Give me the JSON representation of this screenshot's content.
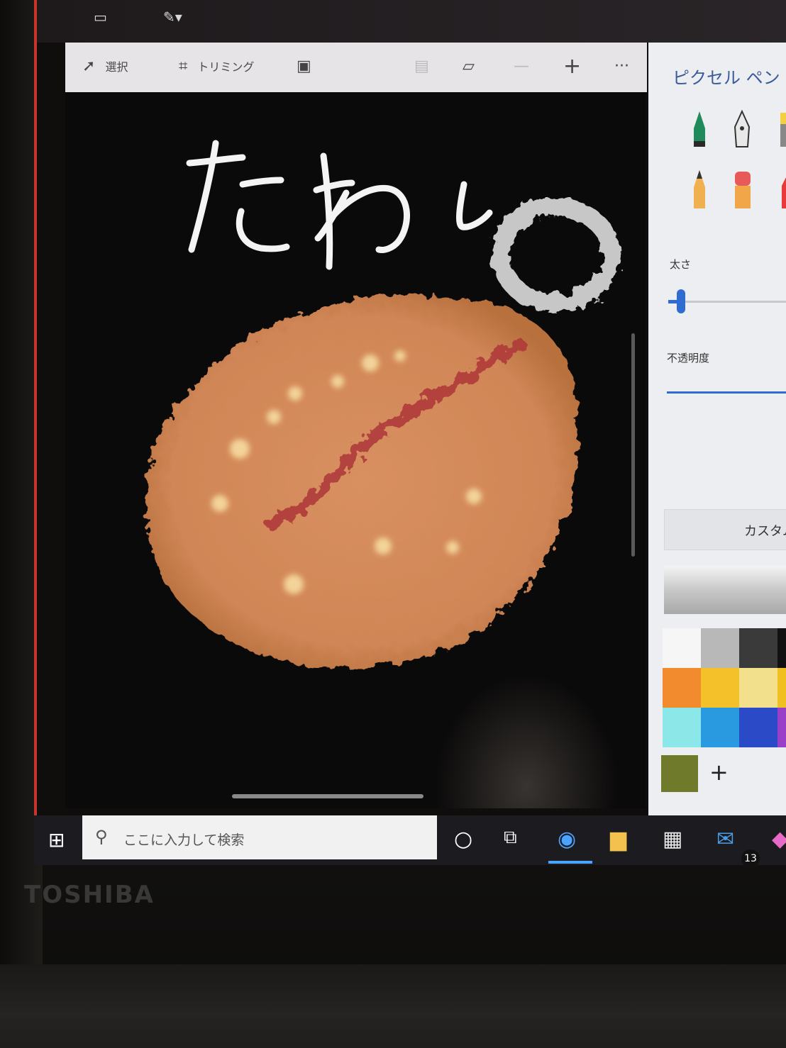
{
  "window": {
    "titlebar_icons": [
      "folder-icon",
      "brush-dropdown-icon"
    ]
  },
  "toolbar": {
    "select_label": "選択",
    "crop_label": "トリミング",
    "magic_select_icon": "magic-select-icon",
    "minus_label": "—",
    "plus_label": "+",
    "more_label": "···"
  },
  "canvas": {
    "handwritten_text": "たわし",
    "background_color": "#0b0a0a",
    "drawing_body_color": "#d48a5a",
    "drawing_stroke_color": "#b03a3a",
    "drawing_ring_color": "#d8d8d8"
  },
  "panel": {
    "title": "ピクセル ペン",
    "thickness_label": "太さ",
    "opacity_label": "不透明度",
    "custom_button_label": "カスタム",
    "thickness_value": 0.1,
    "brushes": [
      "marker-icon",
      "calligraphy-pen-icon",
      "highlighter-icon",
      "pencil-icon",
      "eraser-icon",
      "crayon-icon"
    ],
    "swatches": [
      "#f6f6f6",
      "#b8b8b8",
      "#3a3a3a",
      "#111111",
      "#f28a2e",
      "#f4c12a",
      "#f2e08c",
      "#f0c020",
      "#8ce8e8",
      "#2a9ae0",
      "#2a4ac8",
      "#9a40c8"
    ],
    "current_color": "#6f7a2a",
    "add_color_label": "+"
  },
  "taskbar": {
    "search_placeholder": "ここに入力して検索",
    "mail_badge": "13",
    "icons": [
      "windows-start-icon",
      "cortana-icon",
      "task-view-icon",
      "edge-icon",
      "file-explorer-icon",
      "store-icon",
      "mail-icon",
      "paint3d-icon"
    ]
  },
  "device": {
    "brand": "TOSHIBA"
  }
}
